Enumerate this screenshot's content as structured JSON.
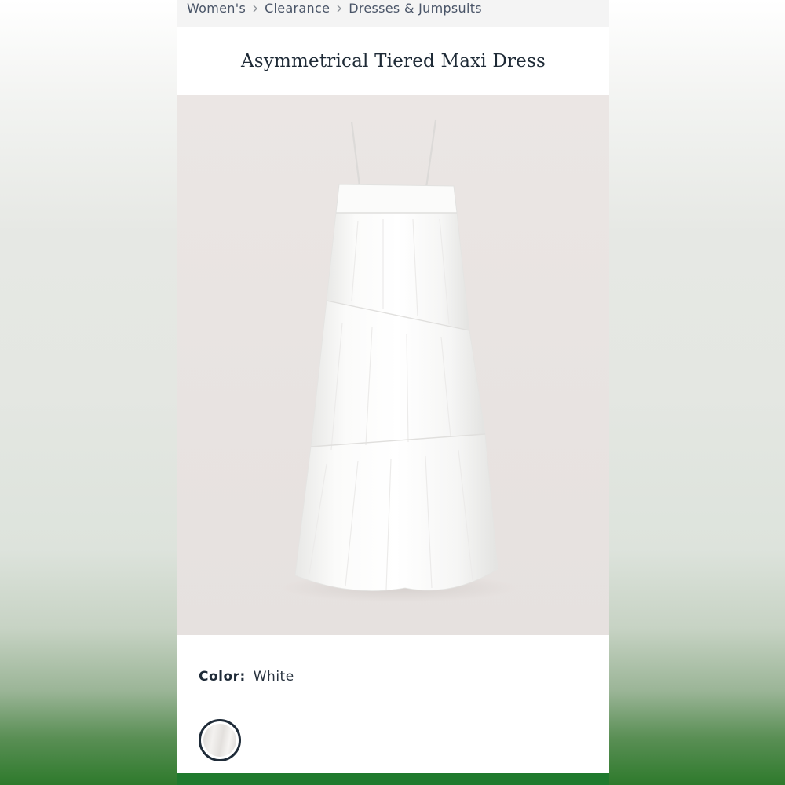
{
  "breadcrumb": {
    "items": [
      {
        "label": "Women's"
      },
      {
        "label": "Clearance"
      },
      {
        "label": "Dresses & Jumpsuits"
      }
    ],
    "separator_icon": "chevron-right-icon"
  },
  "product": {
    "title": "Asymmetrical Tiered Maxi Dress",
    "image_subject": "white-tiered-maxi-dress",
    "color_label": "Color:",
    "color_value": "White",
    "swatches": [
      {
        "name": "White",
        "selected": true
      }
    ]
  },
  "colors": {
    "image_background": "#e9e4e2",
    "accent_bar": "#1f7a2e",
    "text_primary": "#1f2b38"
  }
}
